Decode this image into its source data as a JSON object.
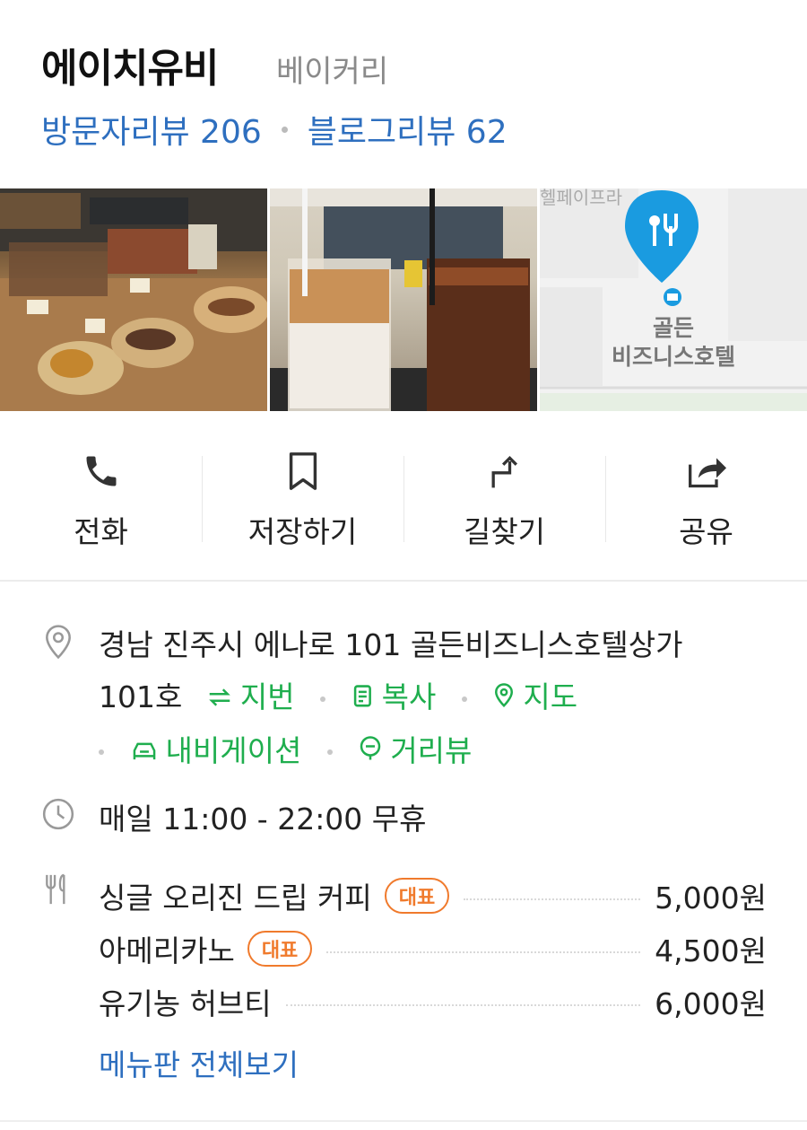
{
  "place": {
    "name": "에이치유비",
    "category": "베이커리",
    "visitor_reviews": "방문자리뷰 206",
    "blog_reviews": "블로그리뷰 62"
  },
  "map_thumb": {
    "label_top": "골든",
    "label_bottom": "비즈니스호텔",
    "label_partial": "헬페이프라"
  },
  "actions": [
    {
      "label": "전화",
      "icon": "phone-icon"
    },
    {
      "label": "저장하기",
      "icon": "bookmark-icon"
    },
    {
      "label": "길찾기",
      "icon": "directions-icon"
    },
    {
      "label": "공유",
      "icon": "share-icon"
    }
  ],
  "address": {
    "line1": "경남 진주시 에나로 101 골든비즈니스호텔상가",
    "line2_prefix": "101호",
    "jibun": "지번",
    "copy": "복사",
    "map": "지도",
    "navigation": "내비게이션",
    "street_view": "거리뷰"
  },
  "hours": "매일 11:00 - 22:00 무휴",
  "menu": {
    "items": [
      {
        "name": "싱글 오리진 드립 커피",
        "badge": "대표",
        "price": "5,000원"
      },
      {
        "name": "아메리카노",
        "badge": "대표",
        "price": "4,500원"
      },
      {
        "name": "유기농 허브티",
        "badge": "",
        "price": "6,000원"
      }
    ],
    "view_all": "메뉴판 전체보기"
  },
  "colors": {
    "link_blue": "#2e6fbf",
    "green": "#1fae4e",
    "badge_orange": "#f07a2c",
    "pin_blue": "#1a9be0"
  }
}
